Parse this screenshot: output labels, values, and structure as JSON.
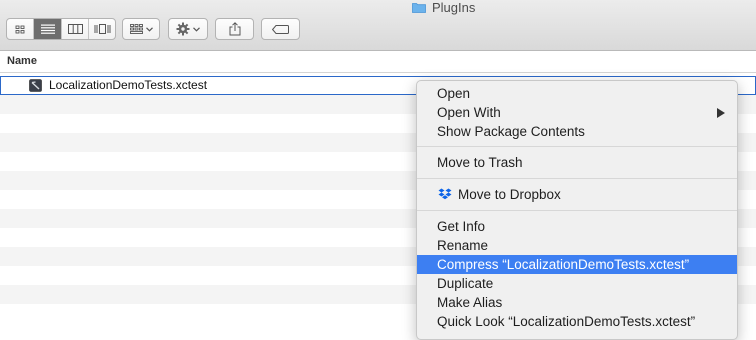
{
  "window": {
    "title": "PlugIns",
    "folder_icon": "folder-icon"
  },
  "toolbar": {
    "view_modes": [
      {
        "name": "icon-view",
        "icon": "grid-icon"
      },
      {
        "name": "list-view",
        "icon": "list-icon",
        "active": true
      },
      {
        "name": "column-view",
        "icon": "columns-icon"
      },
      {
        "name": "coverflow-view",
        "icon": "coverflow-icon"
      }
    ],
    "arrange_icon": "arrange-grid-icon",
    "action_icon": "gear-icon",
    "share_icon": "share-icon",
    "tag_icon": "tag-icon"
  },
  "list": {
    "column_header": "Name",
    "file": {
      "name": "LocalizationDemoTests.xctest",
      "icon": "xctest-bundle-icon"
    }
  },
  "context_menu": {
    "groups": [
      [
        "Open",
        "Open With",
        "Show Package Contents"
      ],
      [
        "Move to Trash"
      ],
      [
        "Move to Dropbox"
      ],
      [
        "Get Info",
        "Rename",
        "Compress “LocalizationDemoTests.xctest”",
        "Duplicate",
        "Make Alias",
        "Quick Look “LocalizationDemoTests.xctest”"
      ]
    ],
    "submenu_item": "Open With",
    "highlighted_item": "Compress “LocalizationDemoTests.xctest”",
    "dropbox_icon": "dropbox-icon"
  },
  "colors": {
    "highlight": "#3d7ff2",
    "selection_border": "#2b68c9",
    "dropbox_blue": "#0d64e8",
    "folder_blue": "#6cb3ec"
  }
}
